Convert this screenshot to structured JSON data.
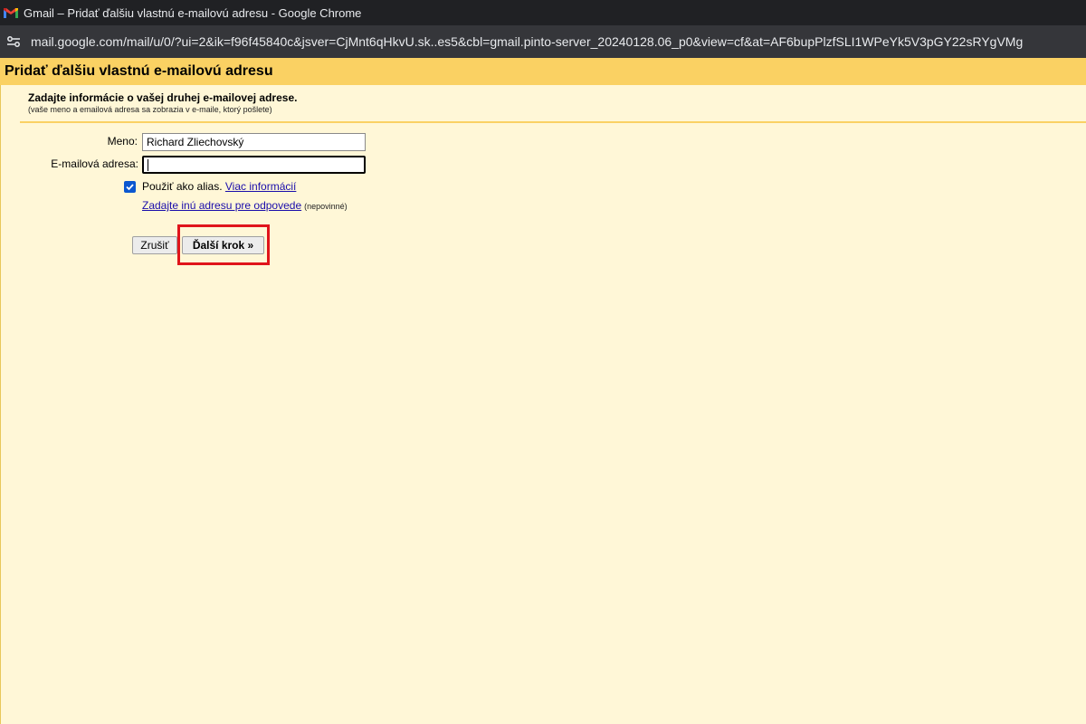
{
  "browser": {
    "window_title": "Gmail – Pridať ďalšiu vlastnú e-mailovú adresu - Google Chrome",
    "url": "mail.google.com/mail/u/0/?ui=2&ik=f96f45840c&jsver=CjMnt6qHkvU.sk..es5&cbl=gmail.pinto-server_20240128.06_p0&view=cf&at=AF6bupPlzfSLI1WPeYk5V3pGY22sRYgVMg",
    "favicon": "gmail-icon",
    "site_icon": "site-settings-icon"
  },
  "dialog": {
    "title": "Pridať ďalšiu vlastnú e-mailovú adresu",
    "intro": "Zadajte informácie o vašej druhej e-mailovej adrese.",
    "intro_sub": "(vaše meno a emailová adresa sa zobrazia v e-maile, ktorý pošlete)",
    "name_label": "Meno:",
    "name_value": "Richard Zliechovský",
    "email_label": "E-mailová adresa:",
    "email_value": "",
    "alias_checked": true,
    "alias_label": "Použiť ako alias.",
    "more_info_link": "Viac informácií",
    "reply_link": "Zadajte inú adresu pre odpovede",
    "reply_optional": "(nepovinné)",
    "cancel_button": "Zrušiť",
    "next_button": "Ďalší krok »"
  },
  "colors": {
    "header": "#fad163",
    "background": "#fff7d7",
    "highlight": "#e0141b",
    "link": "#1a0dab"
  }
}
